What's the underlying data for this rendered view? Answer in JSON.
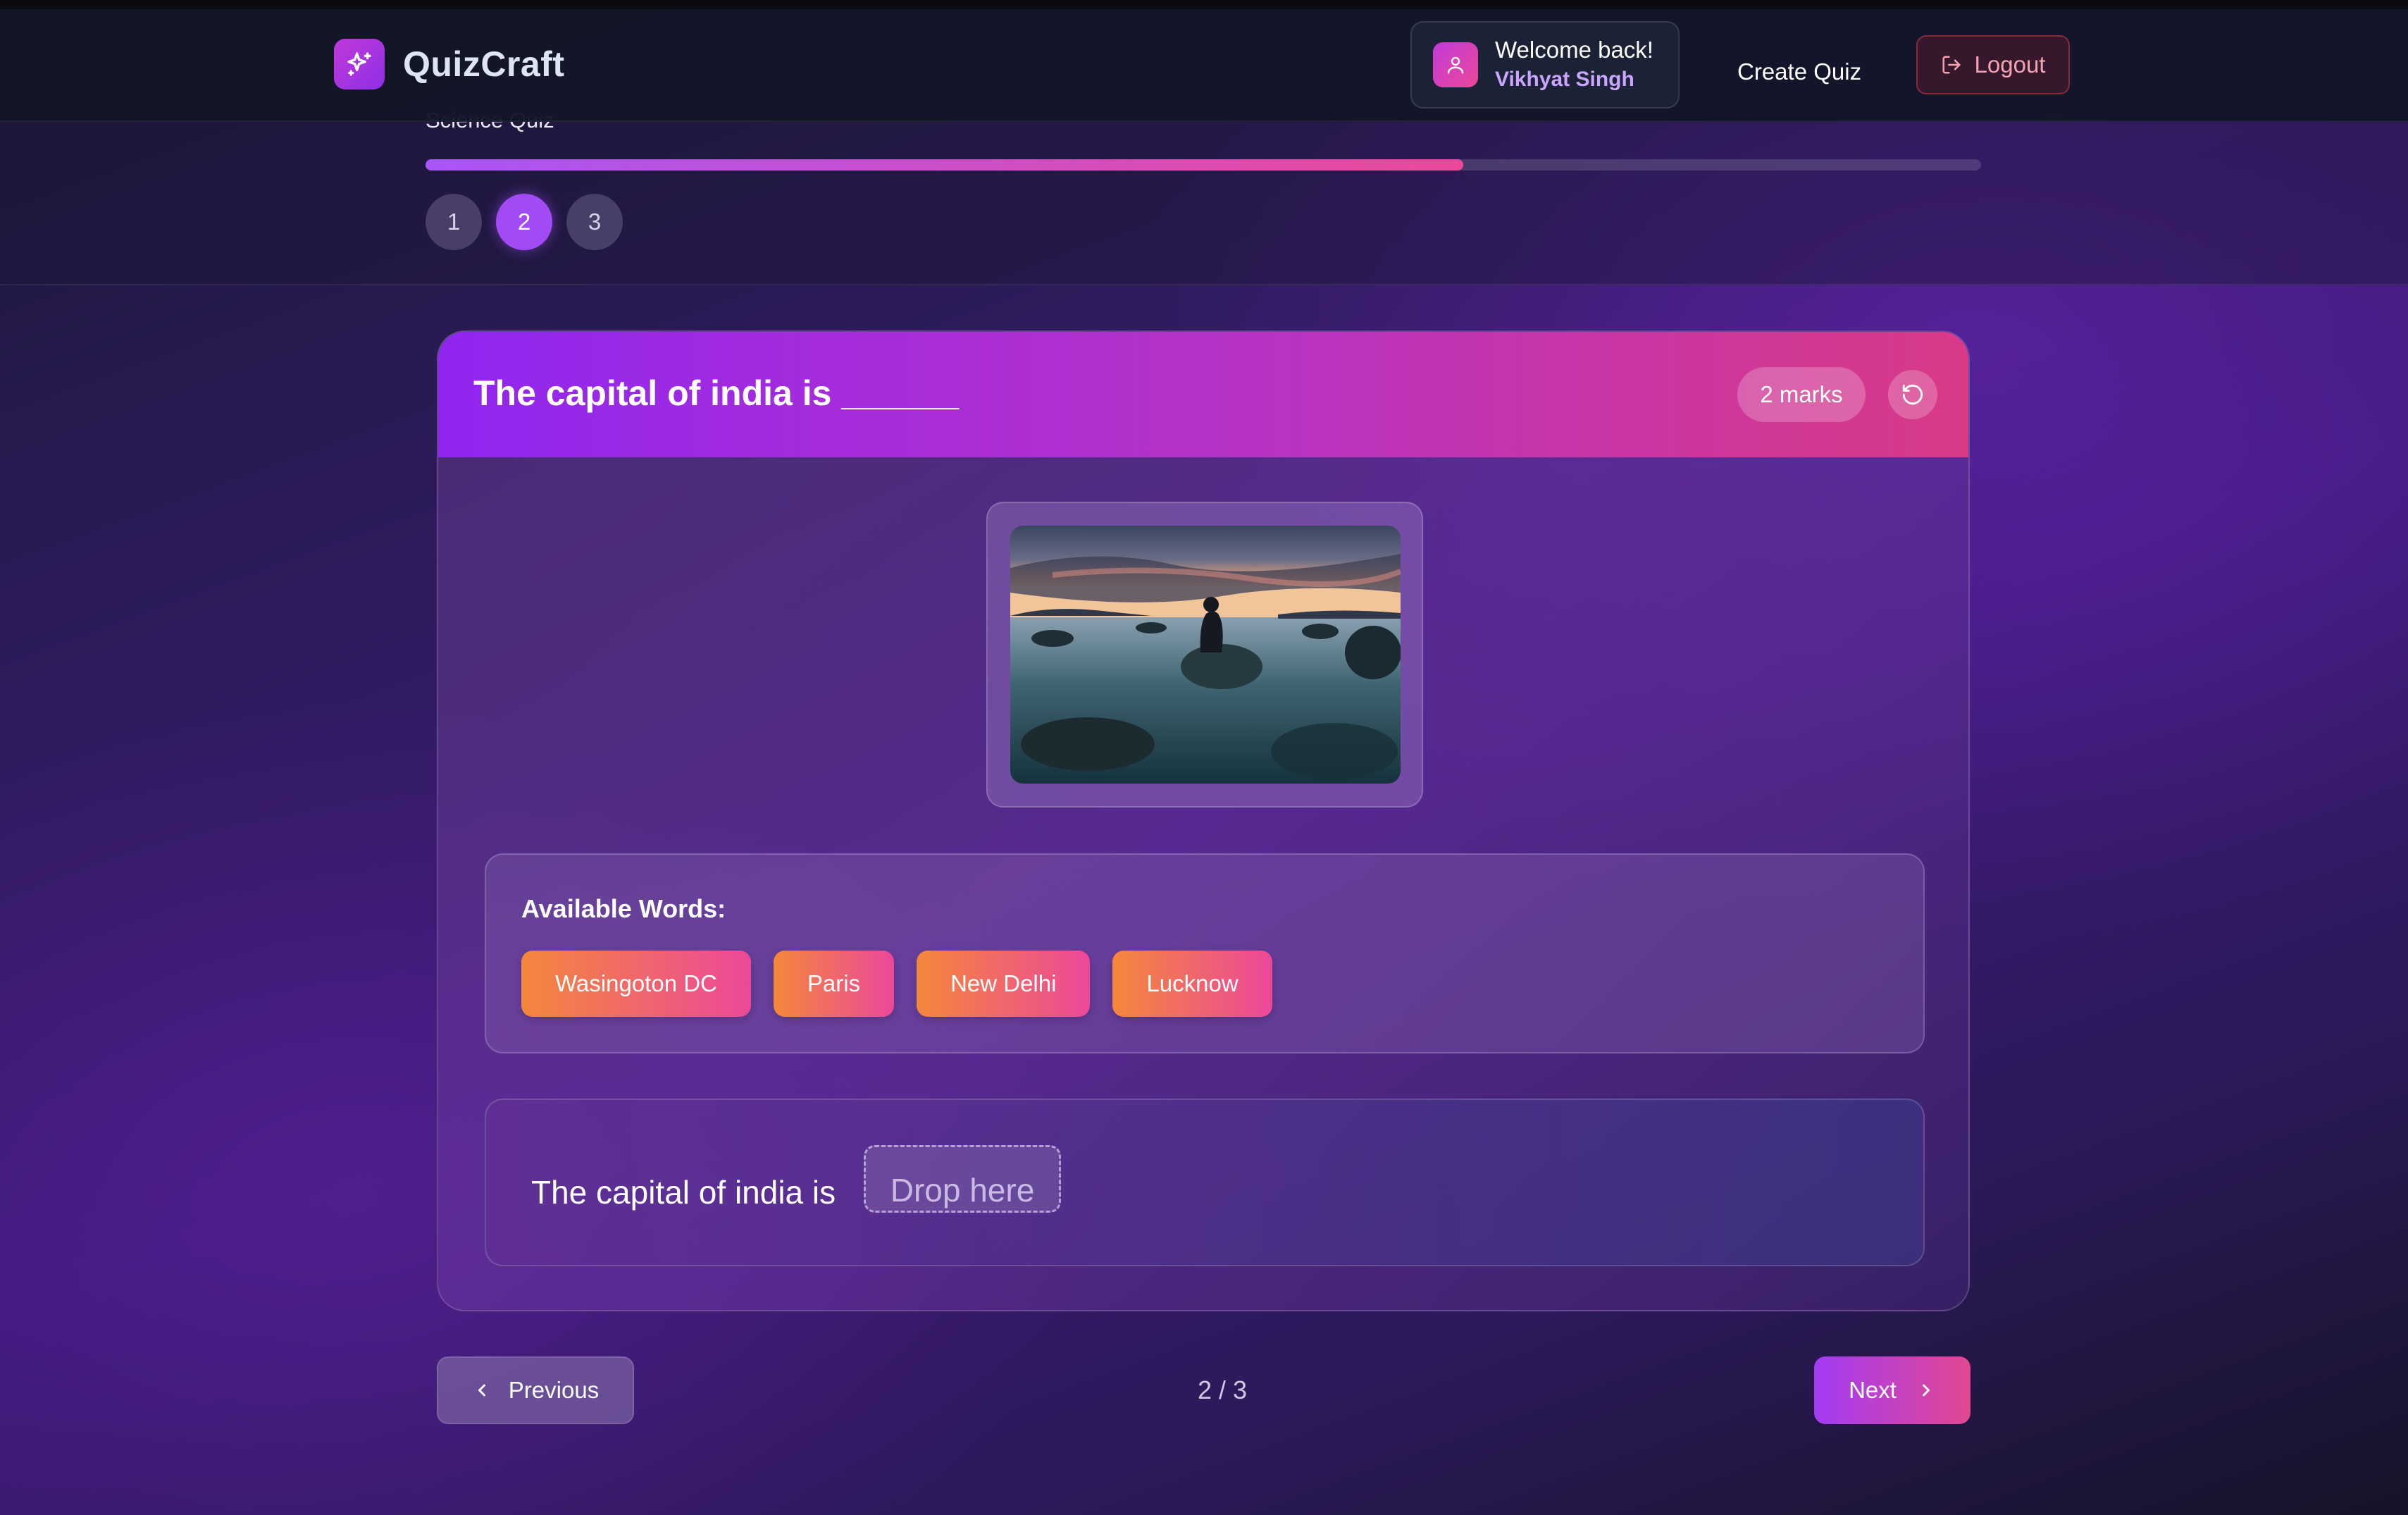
{
  "app": {
    "name": "QuizCraft"
  },
  "header": {
    "welcome_text": "Welcome back!",
    "user_name": "Vikhyat Singh",
    "create_quiz_label": "Create Quiz",
    "logout_label": "Logout"
  },
  "quiz": {
    "title": "Science Quiz",
    "progress_fraction": 0.667,
    "steps": [
      "1",
      "2",
      "3"
    ],
    "active_step": 2
  },
  "question": {
    "title": "The capital of india is ______",
    "marks": "2 marks",
    "image_icon": "photo-person-on-rock-at-sunset",
    "available_words_label": "Available Words:",
    "words": [
      "Wasingoton DC",
      "Paris",
      "New Delhi",
      "Lucknow"
    ],
    "sentence_prefix": "The capital of india is",
    "drop_placeholder": "Drop here"
  },
  "nav": {
    "previous_label": "Previous",
    "next_label": "Next",
    "counter": "2 / 3"
  },
  "colors": {
    "accent_purple": "#a24bf4",
    "accent_pink": "#ec4899",
    "chip_orange": "#f4873c",
    "logout_red": "#f5a3b3"
  }
}
